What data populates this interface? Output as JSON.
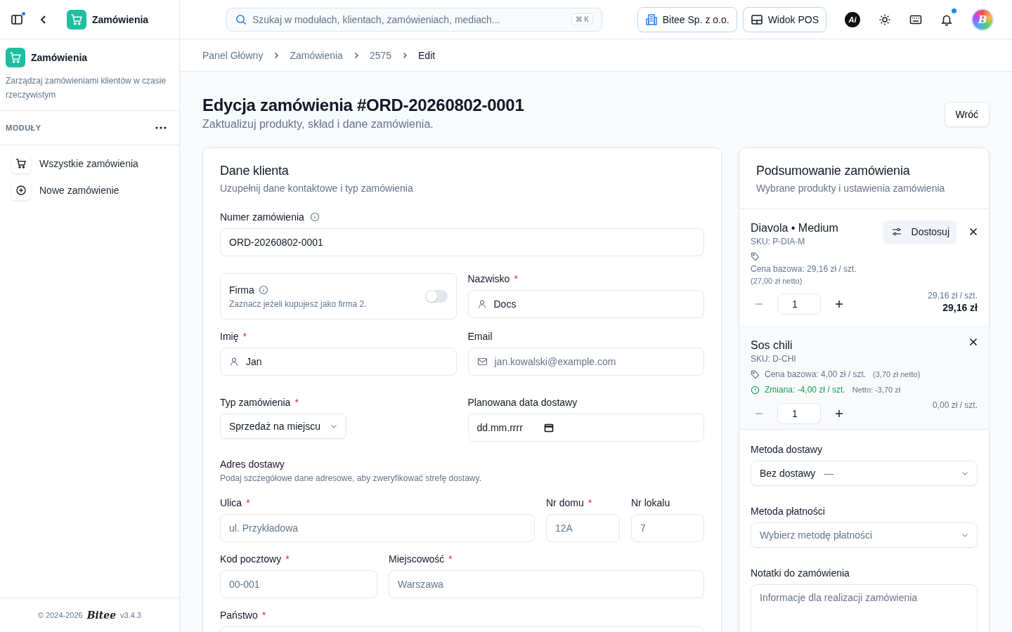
{
  "topbar": {
    "module_title": "Zamówienia",
    "search_placeholder": "Szukaj w modułach, klientach, zamówieniach, mediach...",
    "shortcut": "⌘ K",
    "company": "Bitee Sp. z o.o.",
    "pos_button": "Widok POS",
    "ai_badge": "Ai",
    "notifications_unread": true,
    "sidebar_unread": true,
    "avatar_letter": "B"
  },
  "sidebar": {
    "title": "Zamówienia",
    "description": "Zarządzaj zamówieniami klientów w czasie rzeczywistym",
    "section": "MODUŁY",
    "items": [
      {
        "label": "Wszystkie zamówienia",
        "kind": "list"
      },
      {
        "label": "Nowe zamówienie",
        "kind": "create"
      }
    ],
    "footer": {
      "copyright": "© 2024-2026",
      "brand": "Bitee",
      "version": "v3.4.3"
    }
  },
  "breadcrumb": [
    {
      "label": "Panel Główny",
      "current": false
    },
    {
      "label": "Zamówienia",
      "current": false
    },
    {
      "label": "2575",
      "current": false
    },
    {
      "label": "Edit",
      "current": true
    }
  ],
  "page": {
    "title": "Edycja zamówienia #ORD-20260802-0001",
    "subtitle": "Zaktualizuj produkty, skład i dane zamówienia.",
    "back_button": "Wróć"
  },
  "customer": {
    "title": "Dane klienta",
    "subtitle": "Uzupełnij dane kontaktowe i typ zamówienia",
    "order_number": {
      "label": "Numer zamówienia",
      "value": "ORD-20260802-0001"
    },
    "company": {
      "label": "Firma",
      "hint": "Zaznacz jeżeli kupujesz jako firma 2.",
      "on": false
    },
    "last_name": {
      "label": "Nazwisko",
      "mark": "*",
      "value": "Docs"
    },
    "first_name": {
      "label": "Imię",
      "mark": "*",
      "value": "Jan"
    },
    "email": {
      "label": "Email",
      "placeholder": "jan.kowalski@example.com"
    },
    "order_type": {
      "label": "Typ zamówienia",
      "mark": "*",
      "value": "Sprzedaż na miejscu"
    },
    "delivery_date": {
      "label": "Planowana data dostawy",
      "placeholder": "dd.mm.rrrr"
    },
    "address": {
      "title": "Adres dostawy",
      "subtitle": "Podaj szczegółowe dane adresowe, aby zweryfikować strefę dostawy.",
      "street": {
        "label": "Ulica",
        "mark": "*",
        "placeholder": "ul. Przykładowa"
      },
      "house": {
        "label": "Nr domu",
        "mark": "*",
        "placeholder": "12A"
      },
      "unit": {
        "label": "Nr lokalu",
        "placeholder": "7"
      },
      "postal": {
        "label": "Kod pocztowy",
        "mark": "*",
        "placeholder": "00-001"
      },
      "city": {
        "label": "Miejscowość",
        "mark": "*",
        "placeholder": "Warszawa"
      },
      "country": {
        "label": "Państwo",
        "mark": "*"
      }
    }
  },
  "summary": {
    "title": "Podsumowanie zamówienia",
    "subtitle": "Wybrane produkty i ustawienia zamówienia",
    "items": [
      {
        "name": "Diavola • Medium",
        "sku": "SKU: P-DIA-M",
        "customize": "Dostosuj",
        "base_price": "Cena bazowa: 29,16 zł / szt.",
        "net": "(27,00 zł netto)",
        "quantity": "1",
        "unit_price": "29,16 zł / szt.",
        "total": "29,16 zł"
      },
      {
        "name": "Sos chili",
        "sku": "SKU: D-CHI",
        "base_price": "Cena bazowa: 4,00 zł / szt.",
        "net": "(3,70 zł netto)",
        "change": "Zmiana: -4,00 zł / szt.",
        "change_net": "Netto: -3,70 zł",
        "quantity": "1",
        "unit_price": "0,00 zł / szt."
      }
    ],
    "delivery": {
      "label": "Metoda dostawy",
      "value": "Bez dostawy",
      "extra": "—"
    },
    "payment": {
      "label": "Metoda płatności",
      "placeholder": "Wybierz metodę płatności"
    },
    "notes": {
      "label": "Notatki do zamówienia",
      "placeholder": "Informacje dla realizacji zamówienia"
    }
  }
}
